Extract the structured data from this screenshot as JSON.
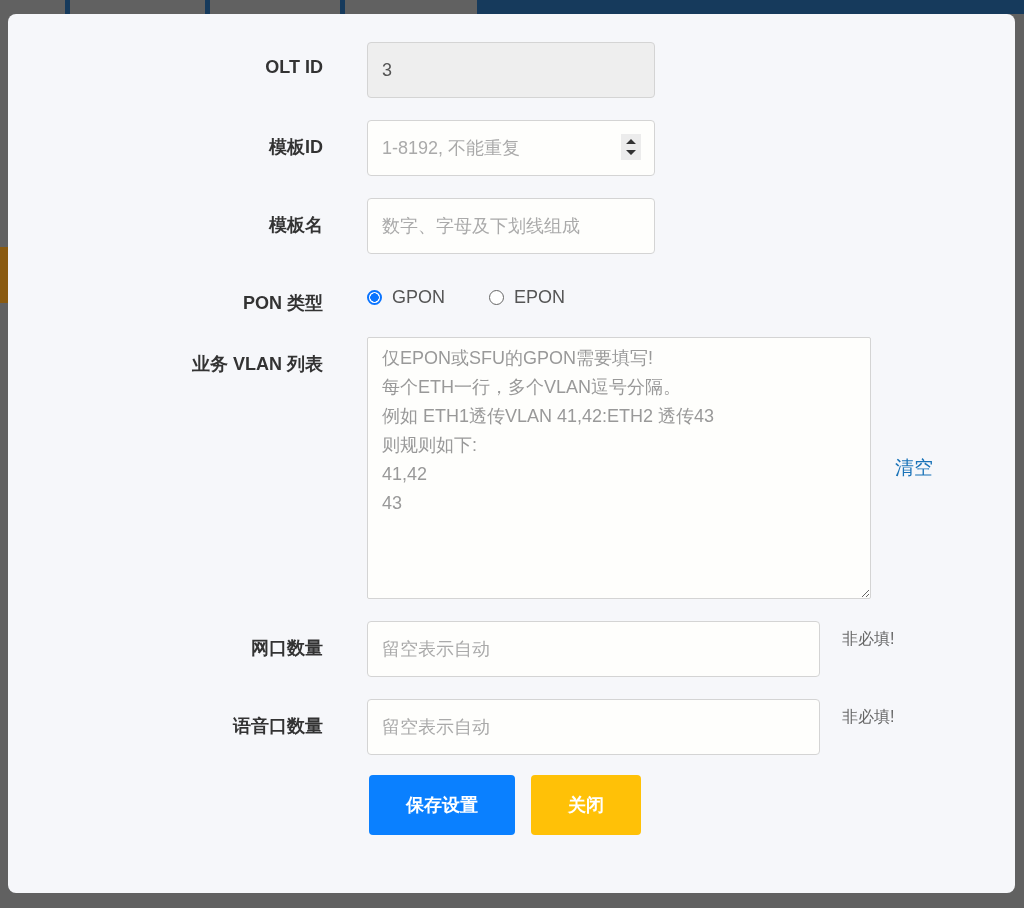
{
  "fields": [
    {
      "kind": "text",
      "label": "OLT ID",
      "value": "3",
      "disabled": true
    },
    {
      "kind": "number",
      "label": "模板ID",
      "placeholder": "1-8192, 不能重复",
      "disabled": false
    },
    {
      "kind": "text",
      "label": "模板名",
      "placeholder": "数字、字母及下划线组成",
      "disabled": false
    },
    {
      "kind": "radio",
      "label": "PON 类型",
      "options": [
        {
          "label": "GPON",
          "selected": true
        },
        {
          "label": "EPON",
          "selected": false
        }
      ]
    },
    {
      "kind": "textarea",
      "label": "业务 VLAN 列表",
      "placeholder": [
        "仅EPON或SFU的GPON需要填写!",
        "每个ETH一行，多个VLAN逗号分隔。",
        "例如 ETH1透传VLAN 41,42:ETH2 透传43",
        "则规则如下:",
        "41,42",
        "43"
      ],
      "action": "清空"
    },
    {
      "kind": "text",
      "label": "网口数量",
      "placeholder": "留空表示自动",
      "hint": "非必填!",
      "disabled": false
    },
    {
      "kind": "text",
      "label": "语音口数量",
      "placeholder": "留空表示自动",
      "hint": "非必填!",
      "disabled": false
    }
  ],
  "buttons": [
    {
      "label": "保存设置",
      "kind": "primary"
    },
    {
      "label": "关闭",
      "kind": "warning"
    }
  ]
}
